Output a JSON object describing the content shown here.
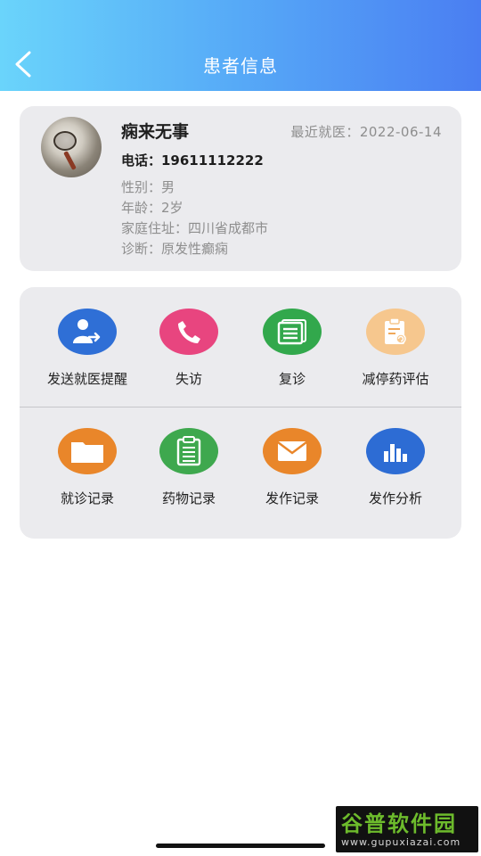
{
  "header": {
    "title": "患者信息",
    "back_icon": "chevron-left-icon"
  },
  "patient": {
    "name": "痫来无事",
    "last_visit": "最近就医：2022-06-14",
    "phone": "电话：19611112222",
    "gender": "性别：男",
    "age": "年龄：2岁",
    "address": "家庭住址：四川省成都市",
    "diagnosis": "诊断：原发性癫痫"
  },
  "actions": [
    {
      "label": "发送就医提醒",
      "icon": "user-send-icon",
      "color": "#2f6fd6"
    },
    {
      "label": "失访",
      "icon": "phone-icon",
      "color": "#e8457f"
    },
    {
      "label": "复诊",
      "icon": "document-stack-icon",
      "color": "#32a84c"
    },
    {
      "label": "减停药评估",
      "icon": "clipboard-refresh-icon",
      "color": "#f6c78e"
    },
    {
      "label": "就诊记录",
      "icon": "folder-icon",
      "color": "#e9862a"
    },
    {
      "label": "药物记录",
      "icon": "clipboard-icon",
      "color": "#3ea84e"
    },
    {
      "label": "发作记录",
      "icon": "envelope-icon",
      "color": "#e9862a"
    },
    {
      "label": "发作分析",
      "icon": "bar-chart-icon",
      "color": "#2d6cd4"
    }
  ],
  "watermark": {
    "title": "谷普软件园",
    "url": "www.gupuxiazai.com"
  }
}
